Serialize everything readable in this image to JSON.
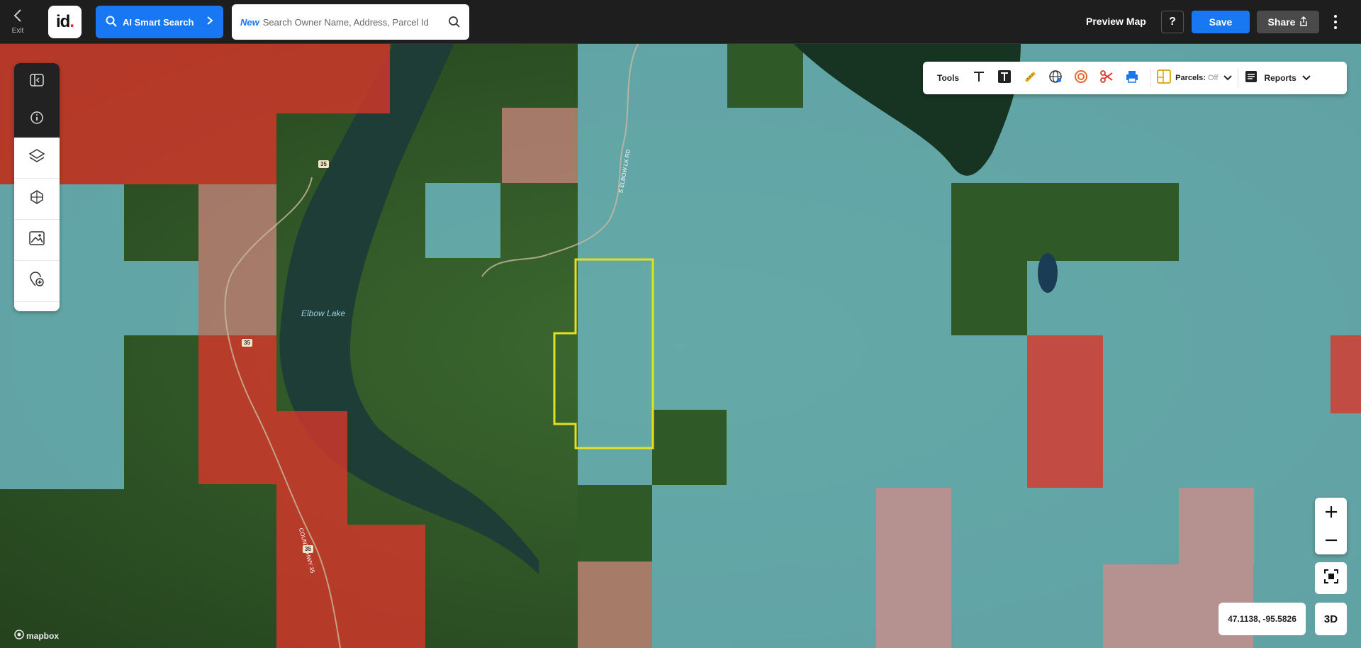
{
  "topbar": {
    "exit_label": "Exit",
    "logo_text": "id",
    "logo_dot": ".",
    "ai_search_label": "AI Smart Search",
    "search_new_label": "New",
    "search_placeholder": "Search Owner Name, Address, Parcel Id",
    "preview_map_label": "Preview Map",
    "help_label": "?",
    "save_label": "Save",
    "share_label": "Share"
  },
  "tools": {
    "tools_label": "Tools",
    "parcels_label": "Parcels:",
    "parcels_state": "Off",
    "reports_label": "Reports"
  },
  "map": {
    "lake_label": "Elbow Lake",
    "road_label_1": "S ELBOW LK RD",
    "road_label_2": "COUNTY HWY 35",
    "route_shield_1": "35",
    "route_shield_2": "35",
    "route_shield_3": "35",
    "coordinates": "47.1138, -95.5826",
    "three_d_label": "3D",
    "attribution": "mapbox"
  },
  "colors": {
    "accent": "#1877f2",
    "parcel_outline": "#e3e022",
    "red_overlay": "#e0312b",
    "teal_overlay": "#5fb7c8"
  }
}
